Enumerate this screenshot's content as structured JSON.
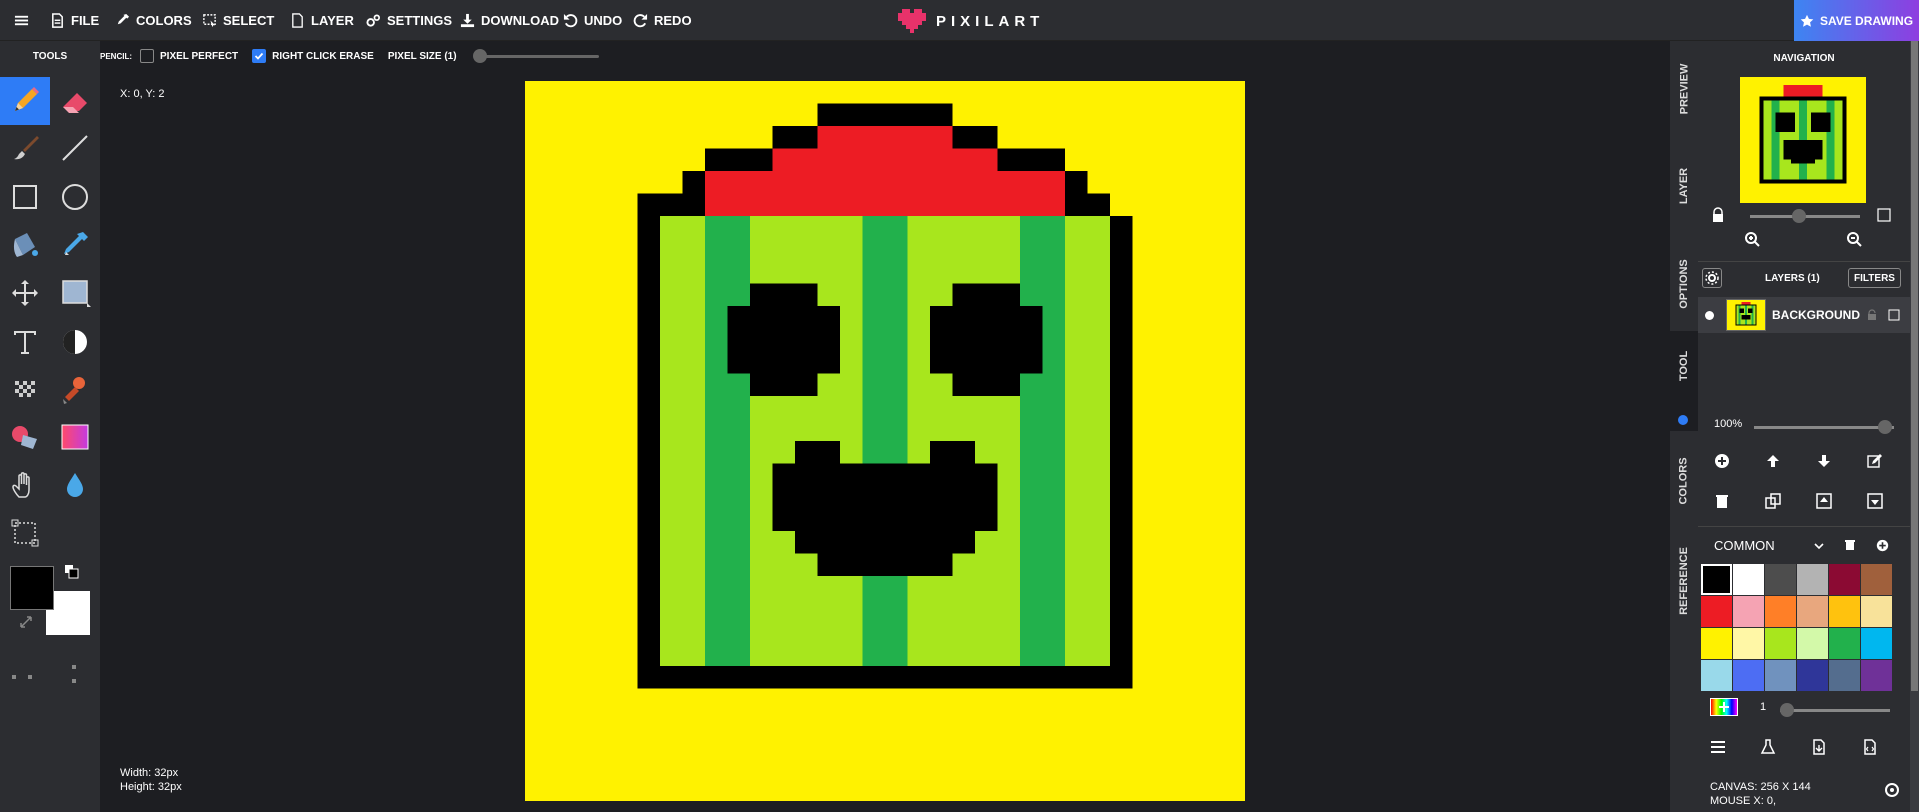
{
  "menu": {
    "file": "FILE",
    "colors": "COLORS",
    "select": "SELECT",
    "layer": "LAYER",
    "settings": "SETTINGS",
    "download": "DOWNLOAD",
    "undo": "UNDO",
    "redo": "REDO"
  },
  "logo": {
    "text": "PIXILART",
    "heart_color": "#e8326a"
  },
  "save_button": "SAVE DRAWING",
  "options_bar": {
    "tool_name": "PENCIL:",
    "pixel_perfect": {
      "label": "PIXEL PERFECT",
      "checked": false
    },
    "right_click_erase": {
      "label": "RIGHT CLICK ERASE",
      "checked": true
    },
    "pixel_size_label": "PIXEL SIZE (1)"
  },
  "tools": {
    "title": "TOOLS",
    "active": "pencil",
    "items": [
      "pencil-icon",
      "eraser-icon",
      "brush-icon",
      "line-icon",
      "rectangle-icon",
      "circle-icon",
      "bucket-icon",
      "eyedropper-icon",
      "move-icon",
      "select-shape-icon",
      "text-icon",
      "lighten-icon",
      "dither-icon",
      "stamp-icon",
      "shading-icon",
      "gradient-icon",
      "hand-icon",
      "blur-icon",
      "selection-icon"
    ]
  },
  "workspace": {
    "coords": "X: 0, Y: 2",
    "width": "Width: 32px",
    "height": "Height: 32px"
  },
  "colors": {
    "primary": "#000000",
    "secondary": "#ffffff",
    "accent": "#2e7cf6",
    "canvas_bg": "#fff200"
  },
  "side_tabs": [
    "PREVIEW",
    "LAYER",
    "OPTIONS",
    "TOOL",
    "COLORS",
    "REFERENCE"
  ],
  "navigation": {
    "title": "NAVIGATION"
  },
  "layers": {
    "title": "LAYERS (1)",
    "filters_label": "FILTERS",
    "items": [
      {
        "name": "BACKGROUND"
      }
    ],
    "opacity": "100%"
  },
  "palette": {
    "name": "COMMON",
    "brush_size": "1",
    "colors": [
      "#000000",
      "#ffffff",
      "#4d4d4d",
      "#b3b3b3",
      "#8b0a33",
      "#a0603c",
      "#ed1c24",
      "#f5a3b3",
      "#ff7f27",
      "#e8a77e",
      "#ffc20e",
      "#f8e29a",
      "#fff200",
      "#fff7a6",
      "#a8e61d",
      "#d3f9a9",
      "#22b14c",
      "#00b7ef",
      "#99d9ea",
      "#4d6df3",
      "#7092be",
      "#2f3699",
      "#546d8e",
      "#6f3198"
    ]
  },
  "info": {
    "canvas": "CANVAS: 256 X 144",
    "mouse": "MOUSE X: 0,"
  }
}
